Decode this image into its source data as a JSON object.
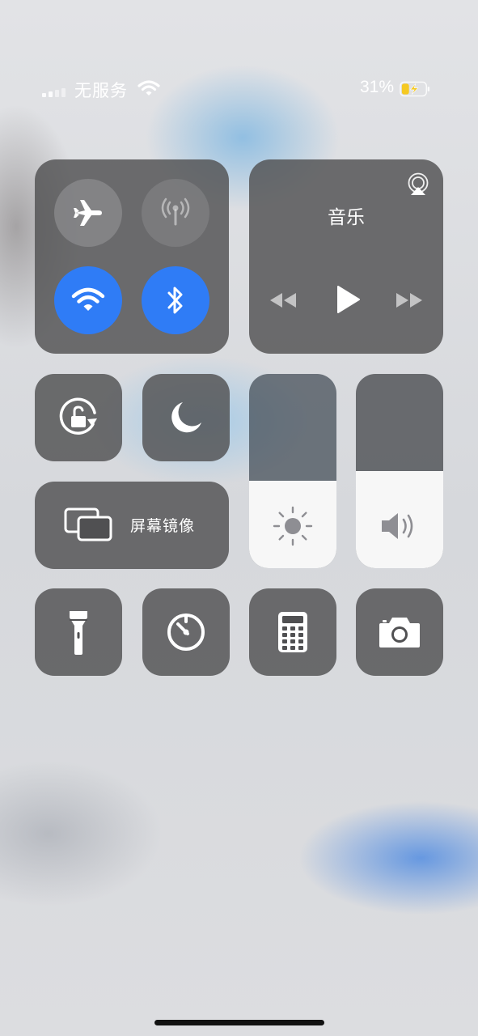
{
  "status_bar": {
    "carrier": "无服务",
    "battery_percent": "31%",
    "battery_level": 0.31,
    "charging": true,
    "battery_color": "#f5c922"
  },
  "connectivity": {
    "airplane_mode": {
      "icon": "airplane-icon",
      "enabled": false
    },
    "cellular_data": {
      "icon": "antenna-icon",
      "enabled": false
    },
    "wifi": {
      "icon": "wifi-icon",
      "enabled": true
    },
    "bluetooth": {
      "icon": "bluetooth-icon",
      "enabled": true
    },
    "accent_color": "#2f7cf6"
  },
  "music": {
    "title": "音乐",
    "airplay_icon": "airplay-icon",
    "controls": [
      "rewind-icon",
      "play-icon",
      "fast-forward-icon"
    ]
  },
  "toggles": {
    "rotation_lock": {
      "icon": "rotation-lock-icon"
    },
    "do_not_disturb": {
      "icon": "moon-icon"
    }
  },
  "screen_mirroring": {
    "label": "屏幕镜像",
    "icon": "screen-mirroring-icon"
  },
  "brightness": {
    "icon": "sun-icon",
    "level": 0.45
  },
  "volume": {
    "icon": "speaker-icon",
    "level": 0.5
  },
  "shortcuts": [
    {
      "name": "flashlight",
      "icon": "flashlight-icon"
    },
    {
      "name": "timer",
      "icon": "timer-icon"
    },
    {
      "name": "calculator",
      "icon": "calculator-icon"
    },
    {
      "name": "camera",
      "icon": "camera-icon"
    }
  ]
}
